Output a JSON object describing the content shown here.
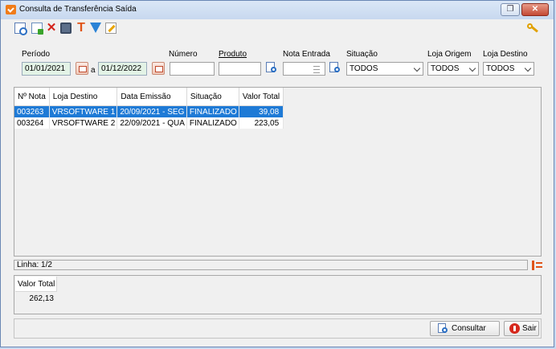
{
  "window": {
    "title": "Consulta de Transferência Saída",
    "restore_glyph": "❐",
    "close_glyph": "✕"
  },
  "toolbar": {
    "icons": [
      "search-doc-icon",
      "new-doc-icon",
      "delete-icon",
      "print-icon",
      "tool-icon",
      "filter-icon",
      "edit-icon"
    ],
    "key_icon": "key-icon"
  },
  "filters": {
    "periodo_label": "Período",
    "date_from": "01/01/2021",
    "a_label": "a",
    "date_to": "01/12/2022",
    "numero_label": "Número",
    "numero_value": "",
    "produto_label": "Produto",
    "produto_value": "",
    "nota_entrada_label": "Nota Entrada",
    "nota_entrada_value": "",
    "situacao_label": "Situação",
    "situacao_value": "TODOS",
    "loja_origem_label": "Loja Origem",
    "loja_origem_value": "TODOS",
    "loja_destino_label": "Loja Destino",
    "loja_destino_value": "TODOS"
  },
  "grid": {
    "columns": [
      "Nº Nota",
      "Loja Destino",
      "Data Emissão",
      "Situação",
      "Valor Total"
    ],
    "rows": [
      [
        "003263",
        "VRSOFTWARE 1",
        "20/09/2021 - SEG",
        "FINALIZADO",
        "39,08"
      ],
      [
        "003264",
        "VRSOFTWARE 2",
        "22/09/2021 - QUA",
        "FINALIZADO",
        "223,05"
      ]
    ],
    "selected_row": 0
  },
  "status": {
    "linha": "Linha: 1/2"
  },
  "totals": {
    "label": "Valor Total",
    "value": "262,13"
  },
  "footer": {
    "consultar_label": "Consultar",
    "sair_label": "Sair"
  },
  "colors": {
    "selection": "#1e7ad6",
    "accent_orange": "#e05418",
    "close_red": "#c44a35"
  }
}
